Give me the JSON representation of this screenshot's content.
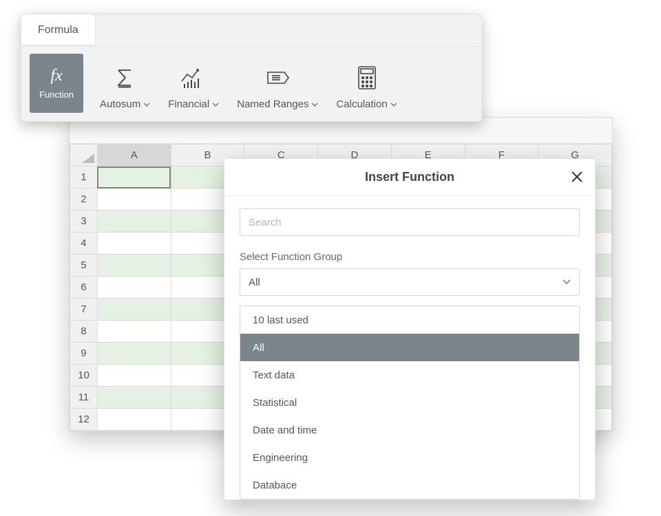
{
  "ribbon": {
    "tab": "Formula",
    "function_btn": "Function",
    "items": [
      {
        "label": "Autosum"
      },
      {
        "label": "Financial"
      },
      {
        "label": "Named Ranges"
      },
      {
        "label": "Calculation"
      }
    ]
  },
  "sheet": {
    "cols": [
      "A",
      "B",
      "C",
      "D",
      "E",
      "F",
      "G"
    ],
    "row_count": 12
  },
  "dialog": {
    "title": "Insert Function",
    "search_placeholder": "Search",
    "group_label": "Select Function Group",
    "group_value": "All",
    "options": [
      "10 last used",
      "All",
      "Text data",
      "Statistical",
      "Date and time",
      "Engineering",
      "Databace"
    ],
    "selected_index": 1
  }
}
